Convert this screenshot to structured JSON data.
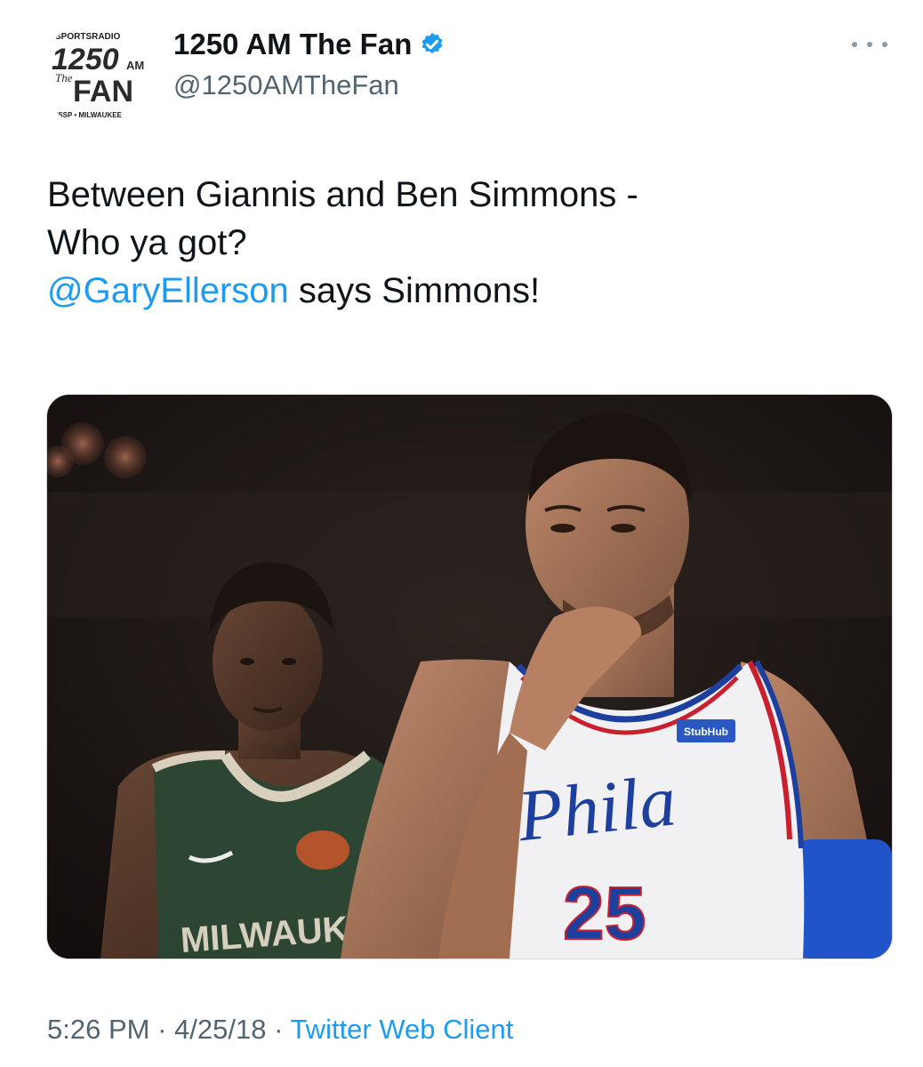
{
  "account": {
    "avatar_icon": "sportsradio-1250am-the-fan-logo",
    "avatar_logo": {
      "top": "SPORTSRADIO",
      "freq": "1250",
      "band": "AM",
      "the": "The",
      "fan": "FAN",
      "bottom": "ESSP • MILWAUKEE"
    },
    "display_name": "1250 AM The Fan",
    "verified_icon": "verified-badge-icon",
    "handle": "@1250AMTheFan",
    "more_icon": "more-options-icon"
  },
  "tweet": {
    "line1": "Between Giannis and Ben Simmons -",
    "line2": "Who ya got?",
    "mention": "@GaryEllerson",
    "line3_rest": " says Simmons!"
  },
  "media": {
    "description_icon": "photo-two-basketball-players",
    "jersey_left_text": "MILWAUKEE",
    "jersey_right_text": "Phila",
    "jersey_right_number": "25",
    "jersey_right_patch": "StubHub"
  },
  "meta": {
    "time": "5:26 PM",
    "sep1": " · ",
    "date": "4/25/18",
    "sep2": " · ",
    "source": "Twitter Web Client"
  },
  "colors": {
    "text": "#0f1419",
    "secondary": "#536471",
    "link": "#1d9bf0",
    "verified": "#1d9bf0",
    "bucks_green": "#2f4a36",
    "sixers_blue": "#1d3f9e",
    "sixers_red": "#c8202f"
  }
}
